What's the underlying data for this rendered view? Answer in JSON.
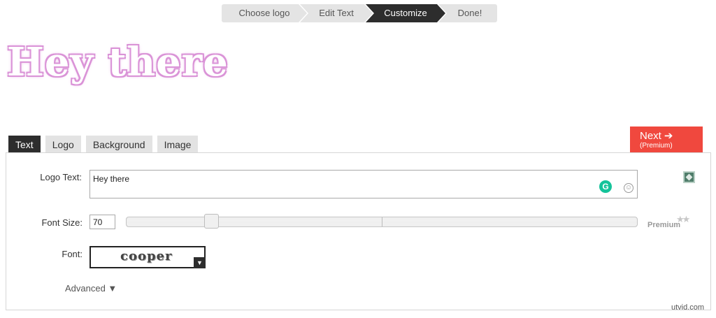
{
  "wizard": {
    "steps": [
      "Choose logo",
      "Edit Text",
      "Customize",
      "Done!"
    ],
    "active_step": "Customize"
  },
  "preview": {
    "logo_text": "Hey there",
    "colors": {
      "fill": "#ffffff",
      "glow": "#d992d6"
    }
  },
  "tabs": [
    "Text",
    "Logo",
    "Background",
    "Image"
  ],
  "active_tab": "Text",
  "next_button": {
    "label": "Next",
    "arrow": "➔",
    "sub": "(Premium)",
    "color": "#f0483e"
  },
  "form": {
    "logo_text_label": "Logo Text:",
    "logo_text_value": "Hey there",
    "font_size_label": "Font Size:",
    "font_size_value": "70",
    "premium_label": "Premium",
    "font_label": "Font:",
    "font_value": "cooper",
    "advanced_label": "Advanced ▼"
  },
  "icons": {
    "grammar": "G",
    "emoji": "☺",
    "premium_stars": "★★"
  },
  "watermark": "utvid.com"
}
